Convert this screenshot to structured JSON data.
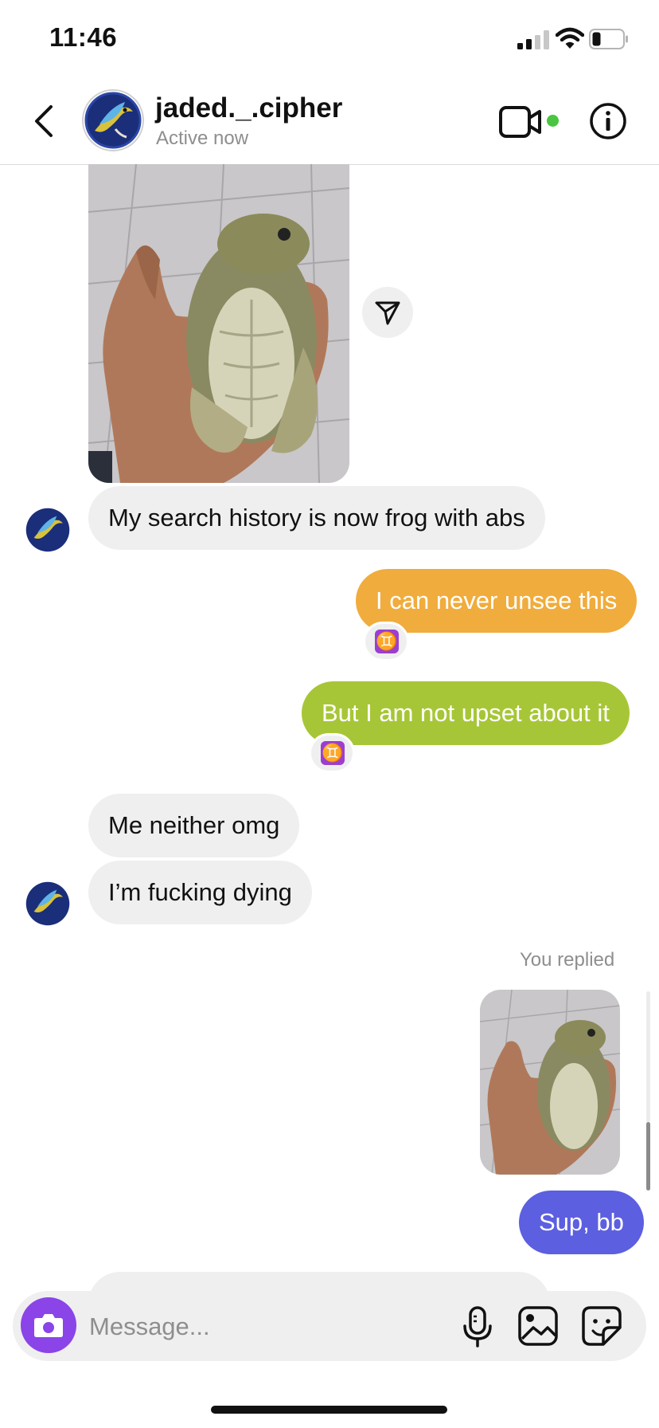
{
  "status_bar": {
    "time": "11:46"
  },
  "header": {
    "username": "jaded._.cipher",
    "presence": "Active now"
  },
  "messages": [
    {
      "id": "m1",
      "direction": "incoming",
      "type": "image",
      "description": "frog with abs"
    },
    {
      "id": "m2",
      "direction": "incoming",
      "type": "text",
      "text": "My search history is now frog with abs"
    },
    {
      "id": "m3",
      "direction": "outgoing",
      "type": "text",
      "text": "I can never unsee this",
      "color": "#f0ac3c",
      "reaction": "♊"
    },
    {
      "id": "m4",
      "direction": "outgoing",
      "type": "text",
      "text": "But I am not upset about it",
      "color": "#a7c637",
      "reaction": "♊"
    },
    {
      "id": "m5",
      "direction": "incoming",
      "type": "text",
      "text": "Me neither omg"
    },
    {
      "id": "m6",
      "direction": "incoming",
      "type": "text",
      "text": "I’m fucking dying"
    },
    {
      "id": "m7",
      "direction": "outgoing",
      "type": "image",
      "label": "You replied"
    },
    {
      "id": "m8",
      "direction": "outgoing",
      "type": "text",
      "text": "Sup, bb",
      "color": "#5c5fe0"
    }
  ],
  "composer": {
    "placeholder": "Message...",
    "icons": [
      "camera-icon",
      "microphone-icon",
      "gallery-icon",
      "sticker-icon"
    ]
  },
  "colors": {
    "incoming_bubble": "#efefef",
    "online": "#49c541",
    "camera_button": "#8a44e8"
  }
}
